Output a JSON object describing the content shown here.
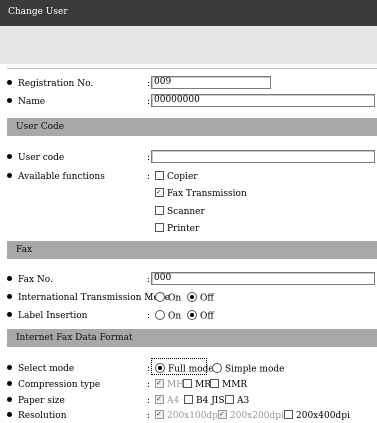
{
  "window": {
    "title": "Change User"
  },
  "registration": {
    "label": "Registration No.",
    "value": "009"
  },
  "name": {
    "label": "Name",
    "value": "00000000"
  },
  "user_code_section": {
    "title": "User Code",
    "user_code_label": "User code",
    "user_code_value": "",
    "available_label": "Available functions",
    "functions": [
      {
        "label": "Copier",
        "checked": false
      },
      {
        "label": "Fax Transmission",
        "checked": true
      },
      {
        "label": "Scanner",
        "checked": false
      },
      {
        "label": "Printer",
        "checked": false
      }
    ]
  },
  "fax_section": {
    "title": "Fax",
    "fax_no_label": "Fax No.",
    "fax_no_value": "000",
    "intl_label": "International Transmission Mode",
    "intl_options": [
      "On",
      "Off"
    ],
    "intl_selected": "Off",
    "label_insertion_label": "Label Insertion",
    "label_options": [
      "On",
      "Off"
    ],
    "label_selected": "Off"
  },
  "ifax_section": {
    "title": "Internet Fax Data Format",
    "select_mode_label": "Select mode",
    "select_mode_options": [
      "Full mode",
      "Simple mode"
    ],
    "select_mode_selected": "Full mode",
    "compression_label": "Compression type",
    "compression_options": [
      {
        "label": "MH",
        "checked": true,
        "disabled": true
      },
      {
        "label": "MR",
        "checked": false,
        "disabled": false
      },
      {
        "label": "MMR",
        "checked": false,
        "disabled": false
      }
    ],
    "paper_label": "Paper size",
    "paper_options": [
      {
        "label": "A4",
        "checked": true,
        "disabled": true
      },
      {
        "label": "B4 JIS",
        "checked": false,
        "disabled": false
      },
      {
        "label": "A3",
        "checked": false,
        "disabled": false
      }
    ],
    "resolution_label": "Resolution",
    "resolution_options": [
      {
        "label": "200x100dpi",
        "checked": true,
        "disabled": true
      },
      {
        "label": "200x200dpi",
        "checked": true,
        "disabled": true
      },
      {
        "label": "200x400dpi",
        "checked": false,
        "disabled": false
      }
    ]
  },
  "colon": ":"
}
